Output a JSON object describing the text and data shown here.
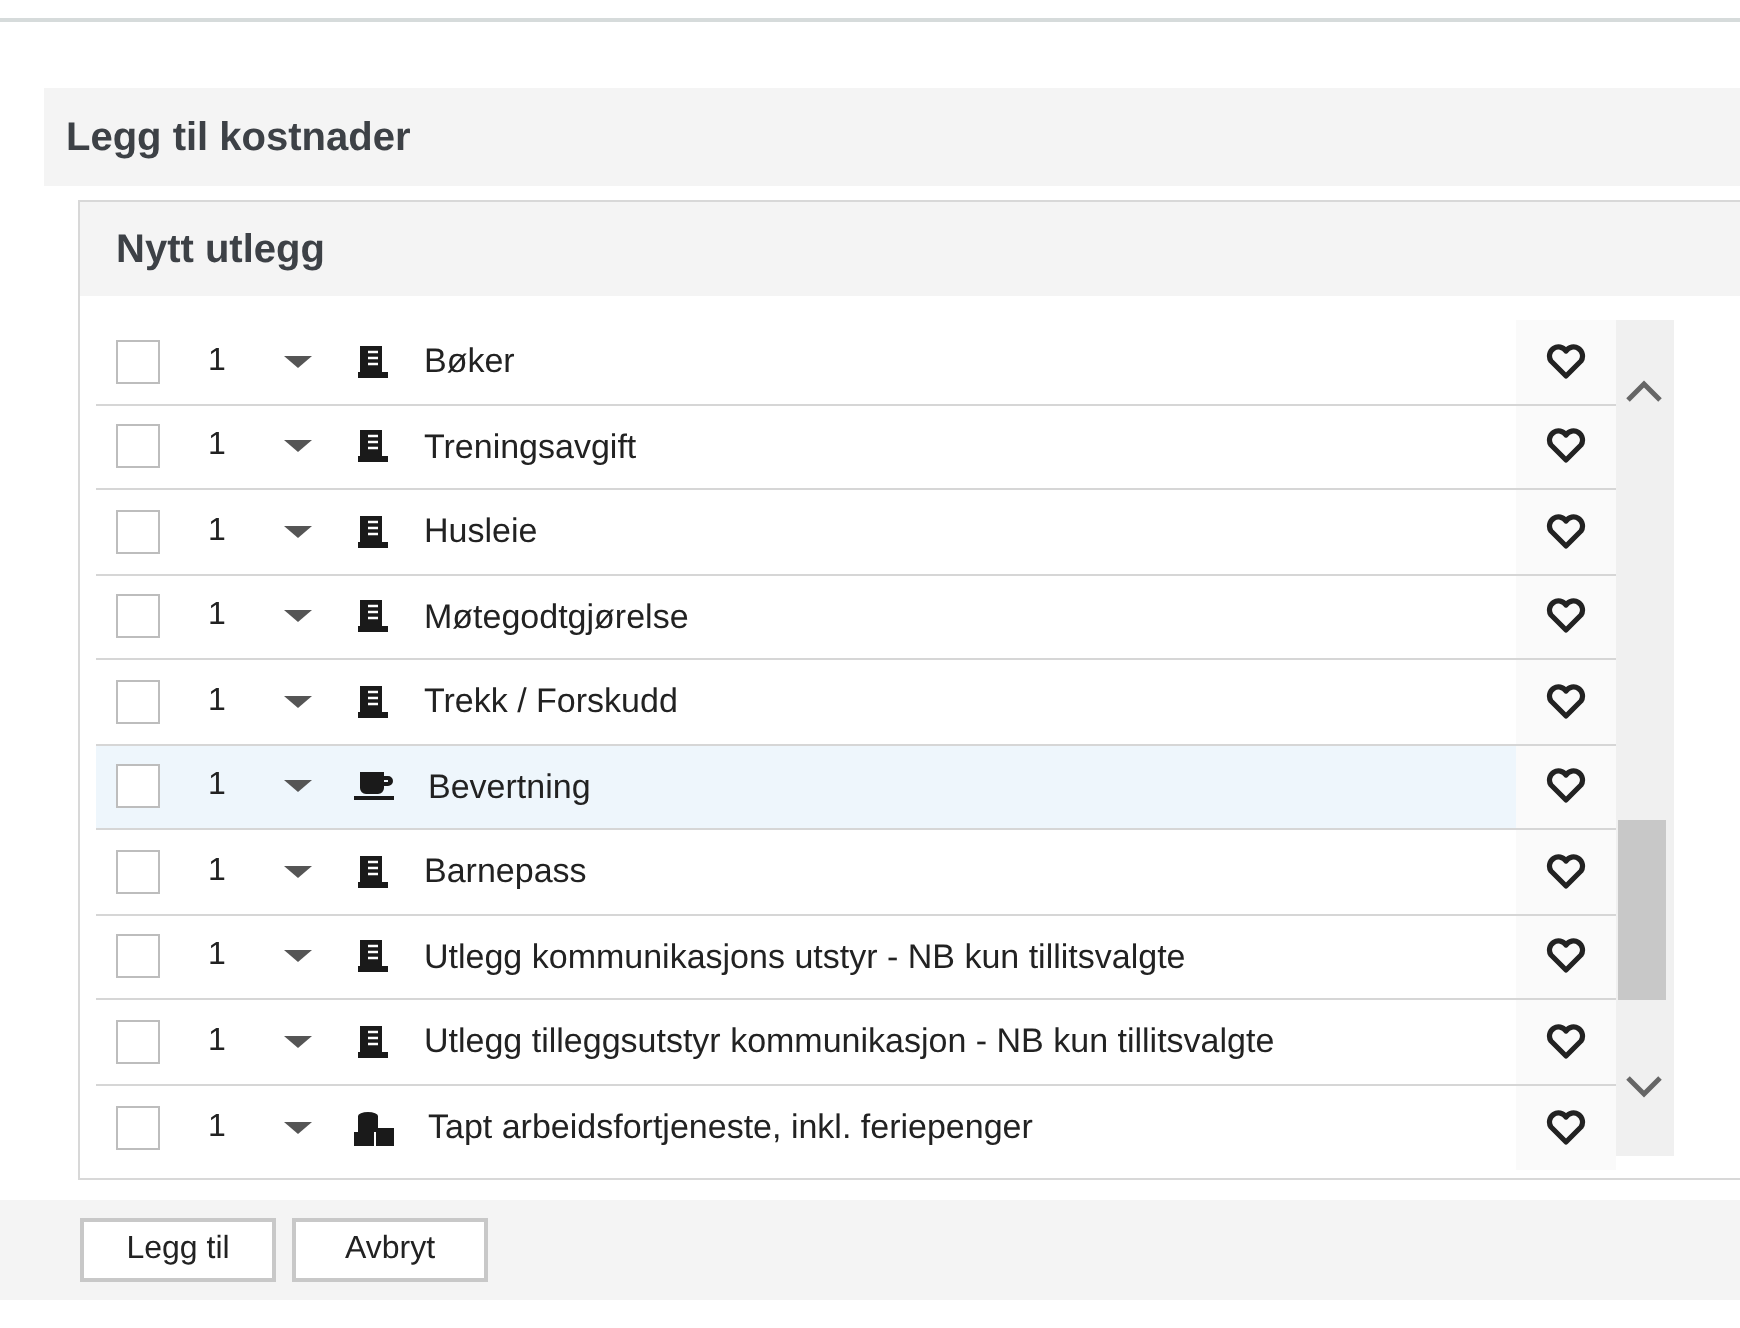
{
  "dialog": {
    "title": "Legg til kostnader"
  },
  "panel": {
    "title": "Nytt utlegg"
  },
  "rows": [
    {
      "checked": false,
      "quantity": "1",
      "kind": "document",
      "label": "Bøker",
      "highlighted": false
    },
    {
      "checked": false,
      "quantity": "1",
      "kind": "document",
      "label": "Treningsavgift",
      "highlighted": false
    },
    {
      "checked": false,
      "quantity": "1",
      "kind": "document",
      "label": "Husleie",
      "highlighted": false
    },
    {
      "checked": false,
      "quantity": "1",
      "kind": "document",
      "label": "Møtegodtgjørelse",
      "highlighted": false
    },
    {
      "checked": false,
      "quantity": "1",
      "kind": "document",
      "label": "Trekk / Forskudd",
      "highlighted": false
    },
    {
      "checked": false,
      "quantity": "1",
      "kind": "cup",
      "label": "Bevertning",
      "highlighted": true
    },
    {
      "checked": false,
      "quantity": "1",
      "kind": "document",
      "label": "Barnepass",
      "highlighted": false
    },
    {
      "checked": false,
      "quantity": "1",
      "kind": "document",
      "label": "Utlegg kommunikasjons utstyr - NB kun tillitsvalgte",
      "highlighted": false
    },
    {
      "checked": false,
      "quantity": "1",
      "kind": "document",
      "label": "Utlegg tilleggsutstyr kommunikasjon - NB kun tillitsvalgte",
      "highlighted": false
    },
    {
      "checked": false,
      "quantity": "1",
      "kind": "coins",
      "label": "Tapt arbeidsfortjeneste, inkl. feriepenger",
      "highlighted": false
    }
  ],
  "buttons": [
    "Legg til",
    "Avbryt"
  ]
}
